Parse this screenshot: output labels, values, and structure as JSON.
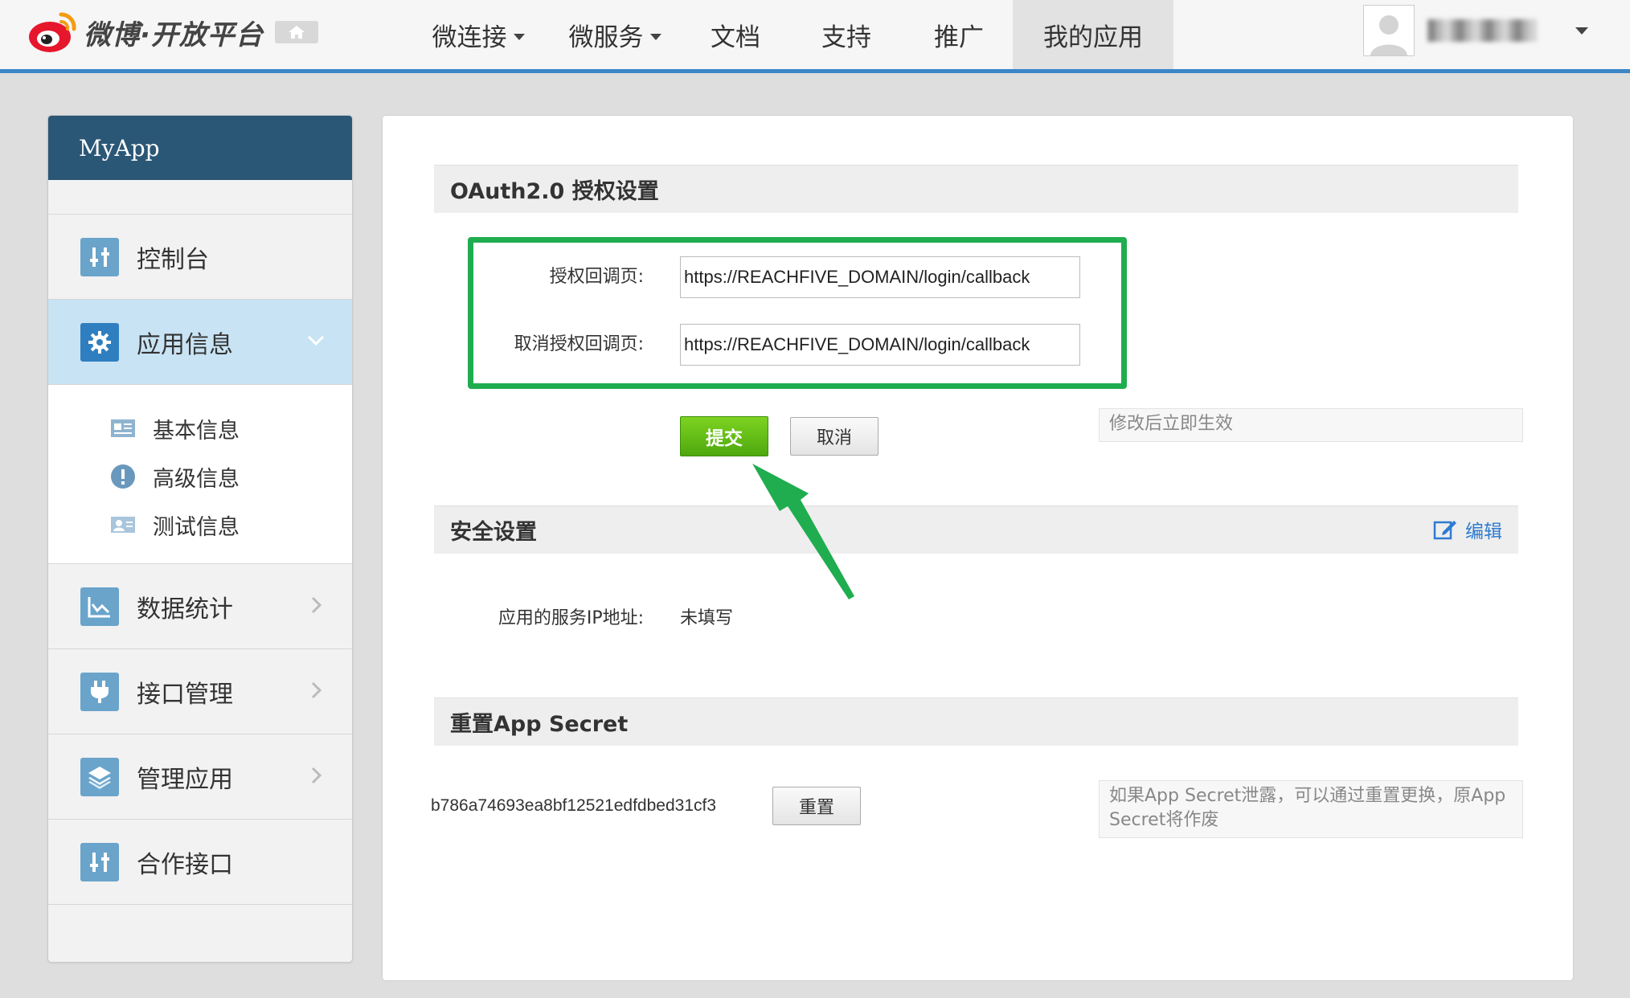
{
  "header": {
    "logo_text": "微博·开放平台",
    "nav": [
      {
        "label": "微连接",
        "dropdown": true
      },
      {
        "label": "微服务",
        "dropdown": true
      },
      {
        "label": "文档",
        "dropdown": false
      },
      {
        "label": "支持",
        "dropdown": false
      },
      {
        "label": "推广",
        "dropdown": false
      },
      {
        "label": "我的应用",
        "dropdown": false,
        "active": true
      }
    ]
  },
  "sidebar": {
    "app_name": "MyApp",
    "items": [
      {
        "label": "控制台",
        "icon": "console-icon"
      },
      {
        "label": "应用信息",
        "icon": "gear-icon",
        "active": true,
        "expanded": true
      },
      {
        "label": "数据统计",
        "icon": "chart-icon"
      },
      {
        "label": "接口管理",
        "icon": "plug-icon"
      },
      {
        "label": "管理应用",
        "icon": "layers-icon"
      },
      {
        "label": "合作接口",
        "icon": "sliders-icon"
      }
    ],
    "sub_items": [
      {
        "label": "基本信息",
        "icon": "card-icon"
      },
      {
        "label": "高级信息",
        "icon": "alert-icon"
      },
      {
        "label": "测试信息",
        "icon": "test-user-icon"
      }
    ]
  },
  "oauth": {
    "title": "OAuth2.0 授权设置",
    "callback_label": "授权回调页:",
    "callback_value": "https://REACHFIVE_DOMAIN/login/callback",
    "cancel_callback_label": "取消授权回调页:",
    "cancel_callback_value": "https://REACHFIVE_DOMAIN/login/callback",
    "submit_label": "提交",
    "cancel_label": "取消",
    "tip": "修改后立即生效"
  },
  "security": {
    "title": "安全设置",
    "edit_label": "编辑",
    "ip_label": "应用的服务IP地址:",
    "ip_value": "未填写"
  },
  "secret": {
    "title": "重置App Secret",
    "value": "b786a74693ea8bf12521edfdbed31cf3",
    "reset_label": "重置",
    "tip": "如果App Secret泄露，可以通过重置更换，原App Secret将作废"
  },
  "colors": {
    "accent": "#3b86c7",
    "sidebar_header": "#2b5776",
    "highlight_green": "#1fad4f",
    "submit_green": "#5cb816"
  }
}
